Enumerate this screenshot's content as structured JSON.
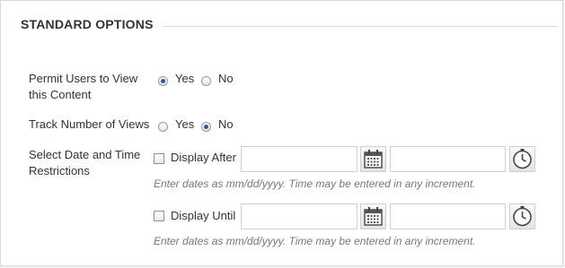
{
  "section": {
    "title": "STANDARD OPTIONS"
  },
  "permit_view": {
    "label_line1": "Permit Users to View",
    "label_line2": "this Content",
    "yes": "Yes",
    "no": "No",
    "selected": "Yes"
  },
  "track_views": {
    "label": "Track Number of Views",
    "yes": "Yes",
    "no": "No",
    "selected": "No"
  },
  "date_restrictions": {
    "label_line1": "Select Date and Time",
    "label_line2": "Restrictions",
    "display_after": {
      "label": "Display After",
      "date_value": "",
      "time_value": "",
      "checked": false,
      "hint": "Enter dates as mm/dd/yyyy. Time may be entered in any increment."
    },
    "display_until": {
      "label": "Display Until",
      "date_value": "",
      "time_value": "",
      "checked": false,
      "hint": "Enter dates as mm/dd/yyyy. Time may be entered in any increment."
    }
  },
  "icons": {
    "calendar": "calendar-icon",
    "clock": "clock-icon"
  }
}
